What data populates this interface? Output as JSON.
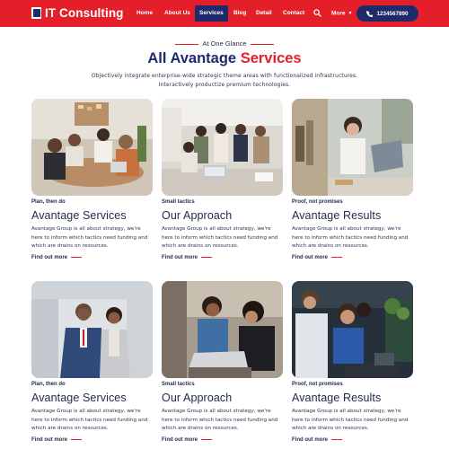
{
  "header": {
    "logo_text": "IT Consulting",
    "nav": [
      {
        "label": "Home"
      },
      {
        "label": "About Us"
      },
      {
        "label": "Services"
      },
      {
        "label": "Blog"
      },
      {
        "label": "Detail"
      },
      {
        "label": "Contact"
      }
    ],
    "active_nav": "Services",
    "more_label": "More",
    "phone": "1234567890",
    "colors": {
      "primary": "#e41f2a",
      "navy": "#1f2a6b"
    }
  },
  "intro": {
    "eyebrow": "At One Glance",
    "title_main": "All Avantage",
    "title_accent": "Services",
    "subtitle": "Objectively integrate enterprise-wide strategic theme areas with functionalized infrastructures. Interactively productize premium technologies."
  },
  "cards": [
    {
      "kicker": "Plan, then do",
      "title": "Avantage Services",
      "body": "Avantage Group is all about strategy, we're here to inform which tactics need funding and which are drains on resources.",
      "link": "Find out more",
      "image": "team-meeting-photo"
    },
    {
      "kicker": "Small tactics",
      "title": "Our Approach",
      "body": "Avantage Group is all about strategy, we're here to inform which tactics need funding and which are drains on resources.",
      "link": "Find out more",
      "image": "office-team-photo"
    },
    {
      "kicker": "Proof, not promises",
      "title": "Avantage Results",
      "body": "Avantage Group is all about strategy, we're here to inform which tactics need funding and which are drains on resources.",
      "link": "Find out more",
      "image": "woman-at-laptop-photo"
    },
    {
      "kicker": "Plan, then do",
      "title": "Avantage Services",
      "body": "Avantage Group is all about strategy, we're here to inform which tactics need funding and which are drains on resources.",
      "link": "Find out more",
      "image": "business-pair-photo"
    },
    {
      "kicker": "Small tactics",
      "title": "Our Approach",
      "body": "Avantage Group is all about strategy, we're here to inform which tactics need funding and which are drains on resources.",
      "link": "Find out more",
      "image": "women-laptop-photo"
    },
    {
      "kicker": "Proof, not promises",
      "title": "Avantage Results",
      "body": "Avantage Group is all about strategy, we're here to inform which tactics need funding and which are drains on resources.",
      "link": "Find out more",
      "image": "smiling-coworkers-photo"
    }
  ]
}
